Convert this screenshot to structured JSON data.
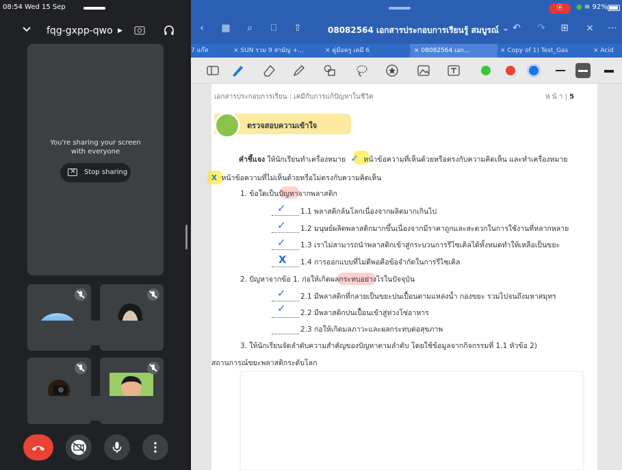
{
  "status": {
    "time": "08:54",
    "date": "Wed 15 Sep",
    "battery": "92%"
  },
  "meet": {
    "meeting_code": "fqg-gxpp-qwo",
    "sharing_line1": "You're sharing your screen",
    "sharing_line2": "with everyone",
    "stop_sharing": "Stop sharing"
  },
  "doc": {
    "title": "08082564 เอกสารประกอบการเรียนรู้ สมบูรณ์",
    "tabs": [
      "7 แก๊ส",
      "SUN รวม 9 สามัญ +...",
      "คู่มือครู เคมี 6",
      "08082564 เอก...",
      "Copy of 1) Test_Gas",
      "Acid"
    ],
    "header": "เอกสารประกอบการเรียน : เคมีกับการแก้ปัญหาในชีวิต",
    "page_label": "ห น้ า",
    "page_number": "5",
    "badge": "ตรวจสอบความเข้าใจ",
    "instruction_bold": "คำชี้แจง",
    "instruction_1": "ให้นักเรียนทำเครื่องหมาย",
    "instruction_2": "หน้าข้อความที่เห็นด้วยหรือตรงกับความคิดเห็น และทำเครื่องหมาย",
    "instruction_3": "หน้าข้อความที่ไม่เห็นด้วยหรือไม่ตรงกับความคิดเห็น",
    "check_glyph": "✓",
    "x_glyph": "X",
    "q1": "1. ข้อใดเป็นปัญหาจากพลาสติก",
    "q1_items": [
      "1.1 พลาสติกล้นโลกเนื่องจากผลิตมากเกินไป",
      "1.2 มนุษย์ผลิตพลาสติกมากขึ้นเนื่องจากมีราคาถูกและสะดวกในการใช้งานที่หลากหลาย",
      "1.3 เราไม่สามารถนำพลาสติกเข้าสู่กระบวนการรีไซเคิลได้ทั้งหมดทำให้เหลือเป็นขยะ",
      "1.4 การออกแบบที่ไม่ดีพอคือข้อจำกัดในการรีไซเคิล"
    ],
    "q1_marks": [
      "✓",
      "✓",
      "✓",
      "X"
    ],
    "q2": "2. ปัญหาจากข้อ 1. ก่อให้เกิดผลกระทบอย่างไรในปัจจุบัน",
    "q2_items": [
      "2.1 มีพลาสติกที่กลายเป็นขยะปนเปื้อนตามแหล่งน้ำ กองขยะ รวมไปจนถึงมหาสมุทร",
      "2.2 มีพลาสติกปนเปื้อนเข้าสู่ห่วงโซ่อาหาร",
      "2.3 ก่อให้เกิดมลภาวะและผลกระทบต่อสุขภาพ"
    ],
    "q2_marks": [
      "✓",
      "✓",
      ""
    ],
    "q3_line1": "3. ให้นักเรียนจัดลำดับความสำคัญของปัญหาตามลำดับ โดยใช้ข้อมูลจากกิจกรรมที่ 1.1 หัวข้อ 2)",
    "q3_line2": "สถานการณ์ขยะพลาสติกระดับโลก"
  },
  "colors": {
    "meet_bg": "#202124",
    "tile_bg": "#3c4043",
    "end_call": "#ea4335",
    "doc_bar": "#2b5fb4",
    "highlight": "#ffe800",
    "pen_green": "#3cc43c",
    "pen_red": "#ea4335",
    "pen_blue": "#1a73e8"
  }
}
